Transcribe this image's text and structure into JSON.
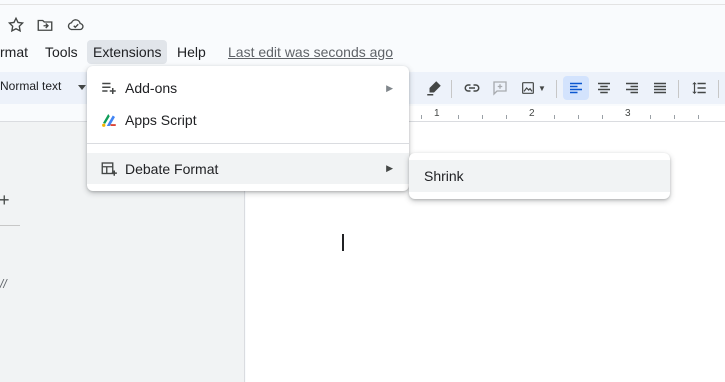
{
  "top_icons": [
    "star-icon",
    "move-to-folder-icon",
    "cloud-saved-icon"
  ],
  "menubar": {
    "items": [
      "rmat",
      "Tools",
      "Extensions",
      "Help"
    ],
    "last_edit": "Last edit was seconds ago"
  },
  "toolbar": {
    "style_value": "Normal text",
    "icons": [
      "highlighter-icon",
      "insert-link-icon",
      "add-comment-icon",
      "insert-image-icon",
      "align-left-icon",
      "align-center-icon",
      "align-right-icon",
      "justify-icon",
      "line-spacing-icon"
    ],
    "selected": "align-left-icon"
  },
  "ruler": {
    "numbers": [
      "1",
      "2",
      "3"
    ]
  },
  "extensions_menu": {
    "items": [
      {
        "label": "Add-ons",
        "icon": "add-ons-icon",
        "has_submenu": true
      },
      {
        "label": "Apps Script",
        "icon": "apps-script-icon",
        "has_submenu": false
      },
      {
        "label": "Debate Format",
        "icon": "add-on-table-icon",
        "has_submenu": true
      }
    ]
  },
  "submenu": {
    "items": [
      "Shrink"
    ]
  },
  "left_panel": {
    "note": "//"
  },
  "colors": {
    "accent": "#0b57d0",
    "selected_bg": "#d3e3fd",
    "hover_bg": "#f1f3f4"
  }
}
